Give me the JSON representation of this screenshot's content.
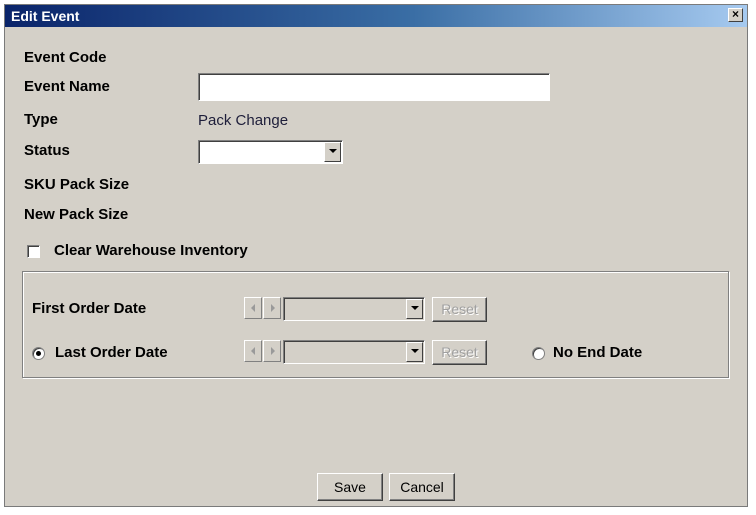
{
  "window": {
    "title": "Edit Event",
    "close_glyph": "×"
  },
  "fields": {
    "event_code_label": "Event Code",
    "event_name_label": "Event Name",
    "event_name_value": "",
    "type_label": "Type",
    "type_value": "Pack Change",
    "status_label": "Status",
    "status_value": "",
    "sku_pack_size_label": "SKU Pack Size",
    "new_pack_size_label": "New Pack Size"
  },
  "clear_inventory": {
    "label": "Clear Warehouse Inventory",
    "checked": false
  },
  "dates": {
    "first_order_label": "First Order Date",
    "last_order_label": "Last Order Date",
    "last_order_selected": true,
    "no_end_label": "No End Date",
    "no_end_selected": false,
    "reset_label": "Reset"
  },
  "footer": {
    "save_label": "Save",
    "cancel_label": "Cancel"
  }
}
